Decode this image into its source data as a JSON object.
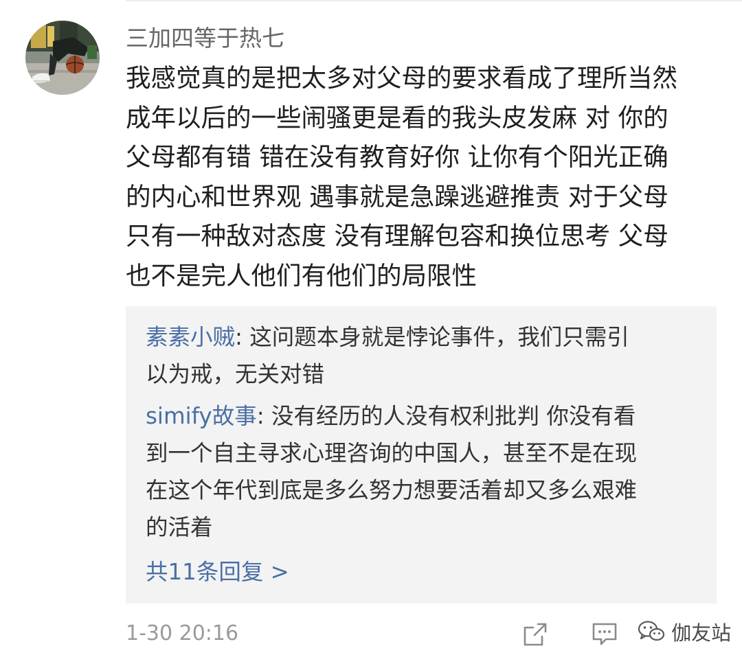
{
  "comment": {
    "username": "三加四等于热七",
    "lines": [
      "我感觉真的是把太多对父母的要求看成了理所当然",
      "成年以后的一些闹骚更是看的我头皮发麻 对 你的",
      "父母都有错 错在没有教育好你 让你有个阳光正确",
      "的内心和世界观 遇事就是急躁逃避推责 对于父母",
      "只有一种敌对态度 没有理解包容和换位思考 父母",
      "也不是完人他们有他们的局限性"
    ],
    "timestamp": "1-30 20:16"
  },
  "replies": [
    {
      "author": "素素小贼",
      "line1": ": 这问题本身就是悖论事件，我们只需引",
      "rest": [
        "以为戒，无关对错"
      ]
    },
    {
      "author": "simify故事",
      "line1": ": 没有经历的人没有权利批判 你没有看",
      "rest": [
        "到一个自主寻求心理咨询的中国人，甚至不是在现",
        "在这个年代到底是多么努力想要活着却又多么艰难",
        "的活着"
      ]
    }
  ],
  "more_replies_label": "共11条回复 >",
  "watermark": {
    "text": "伽友站"
  },
  "colors": {
    "link": "#4a6fa5",
    "reply_background": "#f3f3f3",
    "meta_text": "#9a9a9a"
  },
  "icons": {
    "share": "share-icon",
    "comment": "comment-icon",
    "watermark_logo": "wechat-icon"
  }
}
